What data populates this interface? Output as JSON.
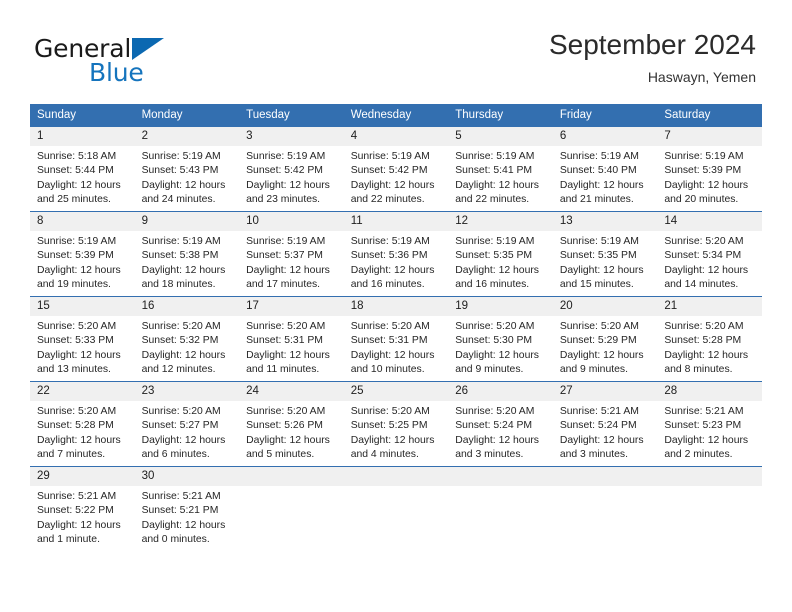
{
  "brand": {
    "name_part1": "General",
    "name_part2": "Blue",
    "accent_color": "#1574bd",
    "triangle_color": "#0b68b1"
  },
  "header": {
    "title": "September 2024",
    "subtitle": "Haswayn, Yemen"
  },
  "theme": {
    "header_row_bg": "#336fb0",
    "header_row_text": "#ffffff",
    "daynum_bg": "#f0f0f0",
    "row_divider": "#336fb0"
  },
  "weekdays": [
    "Sunday",
    "Monday",
    "Tuesday",
    "Wednesday",
    "Thursday",
    "Friday",
    "Saturday"
  ],
  "weeks": [
    [
      {
        "day": "1",
        "sunrise": "Sunrise: 5:18 AM",
        "sunset": "Sunset: 5:44 PM",
        "daylight1": "Daylight: 12 hours",
        "daylight2": "and 25 minutes."
      },
      {
        "day": "2",
        "sunrise": "Sunrise: 5:19 AM",
        "sunset": "Sunset: 5:43 PM",
        "daylight1": "Daylight: 12 hours",
        "daylight2": "and 24 minutes."
      },
      {
        "day": "3",
        "sunrise": "Sunrise: 5:19 AM",
        "sunset": "Sunset: 5:42 PM",
        "daylight1": "Daylight: 12 hours",
        "daylight2": "and 23 minutes."
      },
      {
        "day": "4",
        "sunrise": "Sunrise: 5:19 AM",
        "sunset": "Sunset: 5:42 PM",
        "daylight1": "Daylight: 12 hours",
        "daylight2": "and 22 minutes."
      },
      {
        "day": "5",
        "sunrise": "Sunrise: 5:19 AM",
        "sunset": "Sunset: 5:41 PM",
        "daylight1": "Daylight: 12 hours",
        "daylight2": "and 22 minutes."
      },
      {
        "day": "6",
        "sunrise": "Sunrise: 5:19 AM",
        "sunset": "Sunset: 5:40 PM",
        "daylight1": "Daylight: 12 hours",
        "daylight2": "and 21 minutes."
      },
      {
        "day": "7",
        "sunrise": "Sunrise: 5:19 AM",
        "sunset": "Sunset: 5:39 PM",
        "daylight1": "Daylight: 12 hours",
        "daylight2": "and 20 minutes."
      }
    ],
    [
      {
        "day": "8",
        "sunrise": "Sunrise: 5:19 AM",
        "sunset": "Sunset: 5:39 PM",
        "daylight1": "Daylight: 12 hours",
        "daylight2": "and 19 minutes."
      },
      {
        "day": "9",
        "sunrise": "Sunrise: 5:19 AM",
        "sunset": "Sunset: 5:38 PM",
        "daylight1": "Daylight: 12 hours",
        "daylight2": "and 18 minutes."
      },
      {
        "day": "10",
        "sunrise": "Sunrise: 5:19 AM",
        "sunset": "Sunset: 5:37 PM",
        "daylight1": "Daylight: 12 hours",
        "daylight2": "and 17 minutes."
      },
      {
        "day": "11",
        "sunrise": "Sunrise: 5:19 AM",
        "sunset": "Sunset: 5:36 PM",
        "daylight1": "Daylight: 12 hours",
        "daylight2": "and 16 minutes."
      },
      {
        "day": "12",
        "sunrise": "Sunrise: 5:19 AM",
        "sunset": "Sunset: 5:35 PM",
        "daylight1": "Daylight: 12 hours",
        "daylight2": "and 16 minutes."
      },
      {
        "day": "13",
        "sunrise": "Sunrise: 5:19 AM",
        "sunset": "Sunset: 5:35 PM",
        "daylight1": "Daylight: 12 hours",
        "daylight2": "and 15 minutes."
      },
      {
        "day": "14",
        "sunrise": "Sunrise: 5:20 AM",
        "sunset": "Sunset: 5:34 PM",
        "daylight1": "Daylight: 12 hours",
        "daylight2": "and 14 minutes."
      }
    ],
    [
      {
        "day": "15",
        "sunrise": "Sunrise: 5:20 AM",
        "sunset": "Sunset: 5:33 PM",
        "daylight1": "Daylight: 12 hours",
        "daylight2": "and 13 minutes."
      },
      {
        "day": "16",
        "sunrise": "Sunrise: 5:20 AM",
        "sunset": "Sunset: 5:32 PM",
        "daylight1": "Daylight: 12 hours",
        "daylight2": "and 12 minutes."
      },
      {
        "day": "17",
        "sunrise": "Sunrise: 5:20 AM",
        "sunset": "Sunset: 5:31 PM",
        "daylight1": "Daylight: 12 hours",
        "daylight2": "and 11 minutes."
      },
      {
        "day": "18",
        "sunrise": "Sunrise: 5:20 AM",
        "sunset": "Sunset: 5:31 PM",
        "daylight1": "Daylight: 12 hours",
        "daylight2": "and 10 minutes."
      },
      {
        "day": "19",
        "sunrise": "Sunrise: 5:20 AM",
        "sunset": "Sunset: 5:30 PM",
        "daylight1": "Daylight: 12 hours",
        "daylight2": "and 9 minutes."
      },
      {
        "day": "20",
        "sunrise": "Sunrise: 5:20 AM",
        "sunset": "Sunset: 5:29 PM",
        "daylight1": "Daylight: 12 hours",
        "daylight2": "and 9 minutes."
      },
      {
        "day": "21",
        "sunrise": "Sunrise: 5:20 AM",
        "sunset": "Sunset: 5:28 PM",
        "daylight1": "Daylight: 12 hours",
        "daylight2": "and 8 minutes."
      }
    ],
    [
      {
        "day": "22",
        "sunrise": "Sunrise: 5:20 AM",
        "sunset": "Sunset: 5:28 PM",
        "daylight1": "Daylight: 12 hours",
        "daylight2": "and 7 minutes."
      },
      {
        "day": "23",
        "sunrise": "Sunrise: 5:20 AM",
        "sunset": "Sunset: 5:27 PM",
        "daylight1": "Daylight: 12 hours",
        "daylight2": "and 6 minutes."
      },
      {
        "day": "24",
        "sunrise": "Sunrise: 5:20 AM",
        "sunset": "Sunset: 5:26 PM",
        "daylight1": "Daylight: 12 hours",
        "daylight2": "and 5 minutes."
      },
      {
        "day": "25",
        "sunrise": "Sunrise: 5:20 AM",
        "sunset": "Sunset: 5:25 PM",
        "daylight1": "Daylight: 12 hours",
        "daylight2": "and 4 minutes."
      },
      {
        "day": "26",
        "sunrise": "Sunrise: 5:20 AM",
        "sunset": "Sunset: 5:24 PM",
        "daylight1": "Daylight: 12 hours",
        "daylight2": "and 3 minutes."
      },
      {
        "day": "27",
        "sunrise": "Sunrise: 5:21 AM",
        "sunset": "Sunset: 5:24 PM",
        "daylight1": "Daylight: 12 hours",
        "daylight2": "and 3 minutes."
      },
      {
        "day": "28",
        "sunrise": "Sunrise: 5:21 AM",
        "sunset": "Sunset: 5:23 PM",
        "daylight1": "Daylight: 12 hours",
        "daylight2": "and 2 minutes."
      }
    ],
    [
      {
        "day": "29",
        "sunrise": "Sunrise: 5:21 AM",
        "sunset": "Sunset: 5:22 PM",
        "daylight1": "Daylight: 12 hours",
        "daylight2": "and 1 minute."
      },
      {
        "day": "30",
        "sunrise": "Sunrise: 5:21 AM",
        "sunset": "Sunset: 5:21 PM",
        "daylight1": "Daylight: 12 hours",
        "daylight2": "and 0 minutes."
      },
      {
        "day": "",
        "sunrise": "",
        "sunset": "",
        "daylight1": "",
        "daylight2": ""
      },
      {
        "day": "",
        "sunrise": "",
        "sunset": "",
        "daylight1": "",
        "daylight2": ""
      },
      {
        "day": "",
        "sunrise": "",
        "sunset": "",
        "daylight1": "",
        "daylight2": ""
      },
      {
        "day": "",
        "sunrise": "",
        "sunset": "",
        "daylight1": "",
        "daylight2": ""
      },
      {
        "day": "",
        "sunrise": "",
        "sunset": "",
        "daylight1": "",
        "daylight2": ""
      }
    ]
  ]
}
